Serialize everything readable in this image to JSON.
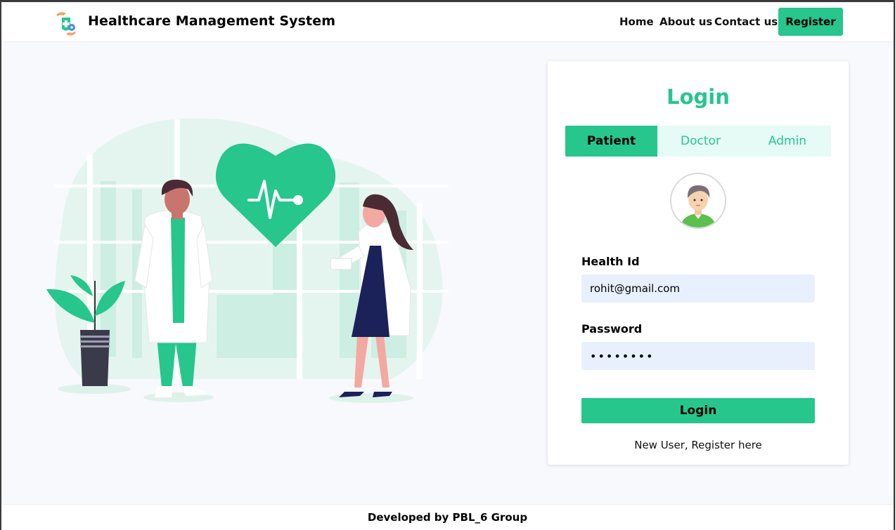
{
  "navbar": {
    "brand_title": "Healthcare Management System",
    "links": {
      "home": "Home",
      "about": "About us",
      "contact": "Contact us"
    },
    "register_label": "Register"
  },
  "login": {
    "title": "Login",
    "tabs": [
      {
        "label": "Patient",
        "active": true
      },
      {
        "label": "Doctor",
        "active": false
      },
      {
        "label": "Admin",
        "active": false
      }
    ],
    "health_id_label": "Health Id",
    "health_id_value": "rohit@gmail.com",
    "password_label": "Password",
    "password_value": "••••••••",
    "submit_label": "Login",
    "register_link": "New User, Register here"
  },
  "footer": {
    "text": "Developed by PBL_6 Group"
  },
  "colors": {
    "accent": "#26c68d",
    "tab_bg": "#e6fbf5",
    "input_bg": "#e8f0fe",
    "page_bg": "#f8f9fd"
  }
}
